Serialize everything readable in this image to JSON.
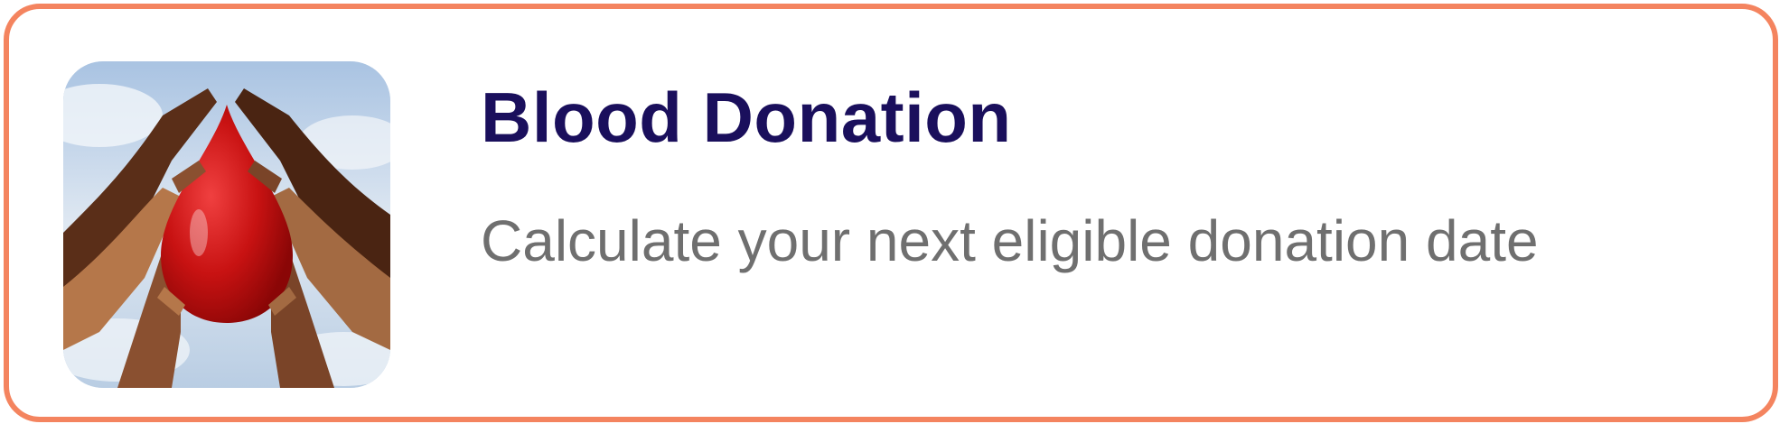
{
  "card": {
    "title": "Blood Donation",
    "subtitle": "Calculate your next eligible donation date",
    "image": {
      "icon": "blood-drop-hands-image"
    }
  },
  "colors": {
    "border": "#f4845f",
    "title": "#1a0f5c",
    "subtitle": "#6f6f6f",
    "drop": "#d01818"
  }
}
